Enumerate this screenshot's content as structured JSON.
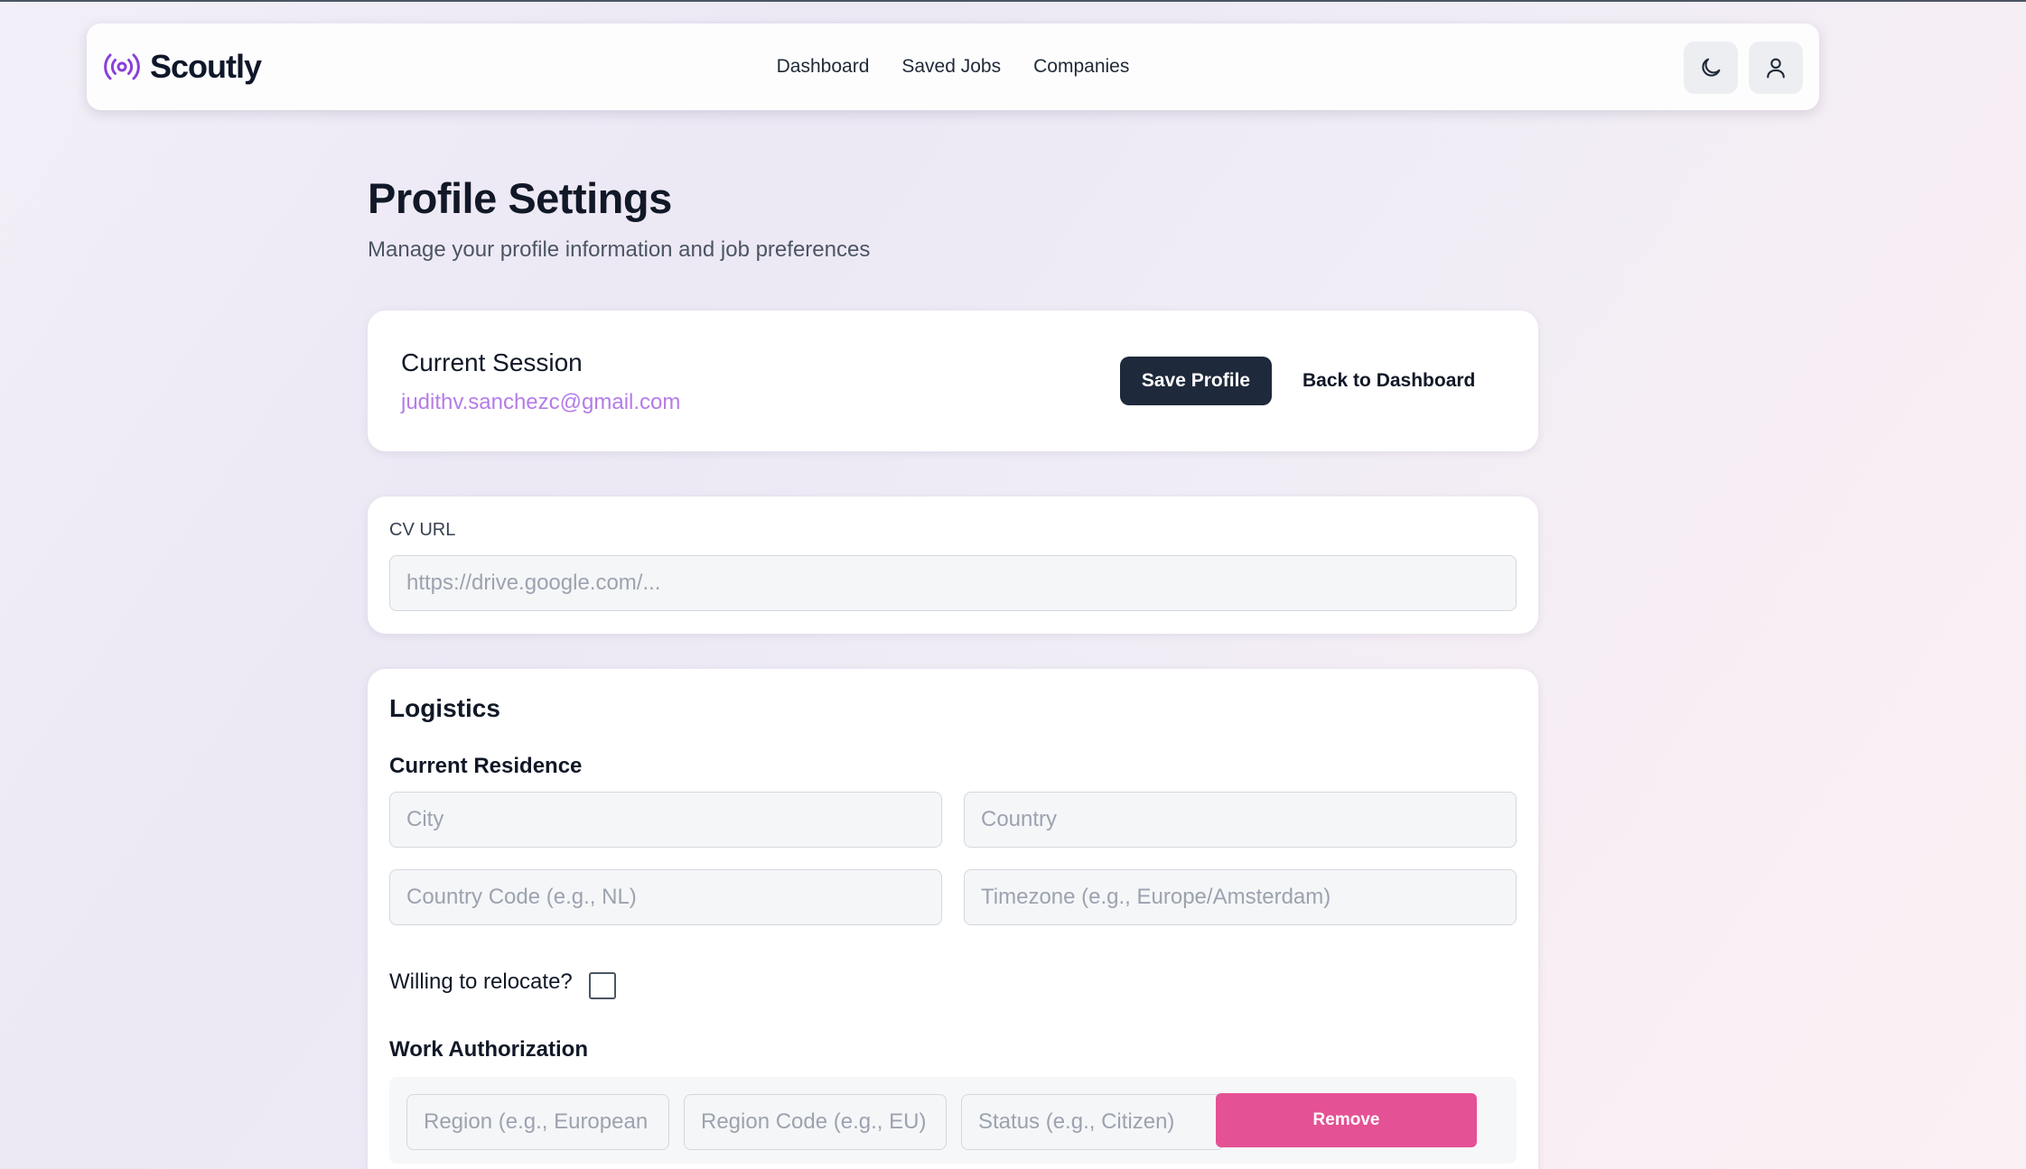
{
  "brand": {
    "name": "Scoutly",
    "icon": "broadcast-icon",
    "accent": "#8b3fd9"
  },
  "nav": {
    "links": [
      "Dashboard",
      "Saved Jobs",
      "Companies"
    ],
    "theme_icon": "moon-icon",
    "user_icon": "user-icon"
  },
  "page": {
    "title": "Profile Settings",
    "subtitle": "Manage your profile information and job preferences"
  },
  "session": {
    "label": "Current Session",
    "email": "judithv.sanchezc@gmail.com",
    "save_label": "Save Profile",
    "back_label": "Back to Dashboard"
  },
  "cv": {
    "label": "CV URL",
    "placeholder": "https://drive.google.com/...",
    "value": ""
  },
  "logistics": {
    "title": "Logistics",
    "residence_title": "Current Residence",
    "city_placeholder": "City",
    "country_placeholder": "Country",
    "country_code_placeholder": "Country Code (e.g., NL)",
    "timezone_placeholder": "Timezone (e.g., Europe/Amsterdam)",
    "relocate_label": "Willing to relocate?",
    "relocate_checked": false,
    "work_auth_title": "Work Authorization",
    "region_placeholder": "Region (e.g., European Union)",
    "region_code_placeholder": "Region Code (e.g., EU)",
    "status_placeholder": "Status (e.g., Citizen)",
    "remove_label": "Remove"
  },
  "colors": {
    "primary_button": "#1e293b",
    "remove_button": "#e45194",
    "email_link": "#b57ce8"
  }
}
